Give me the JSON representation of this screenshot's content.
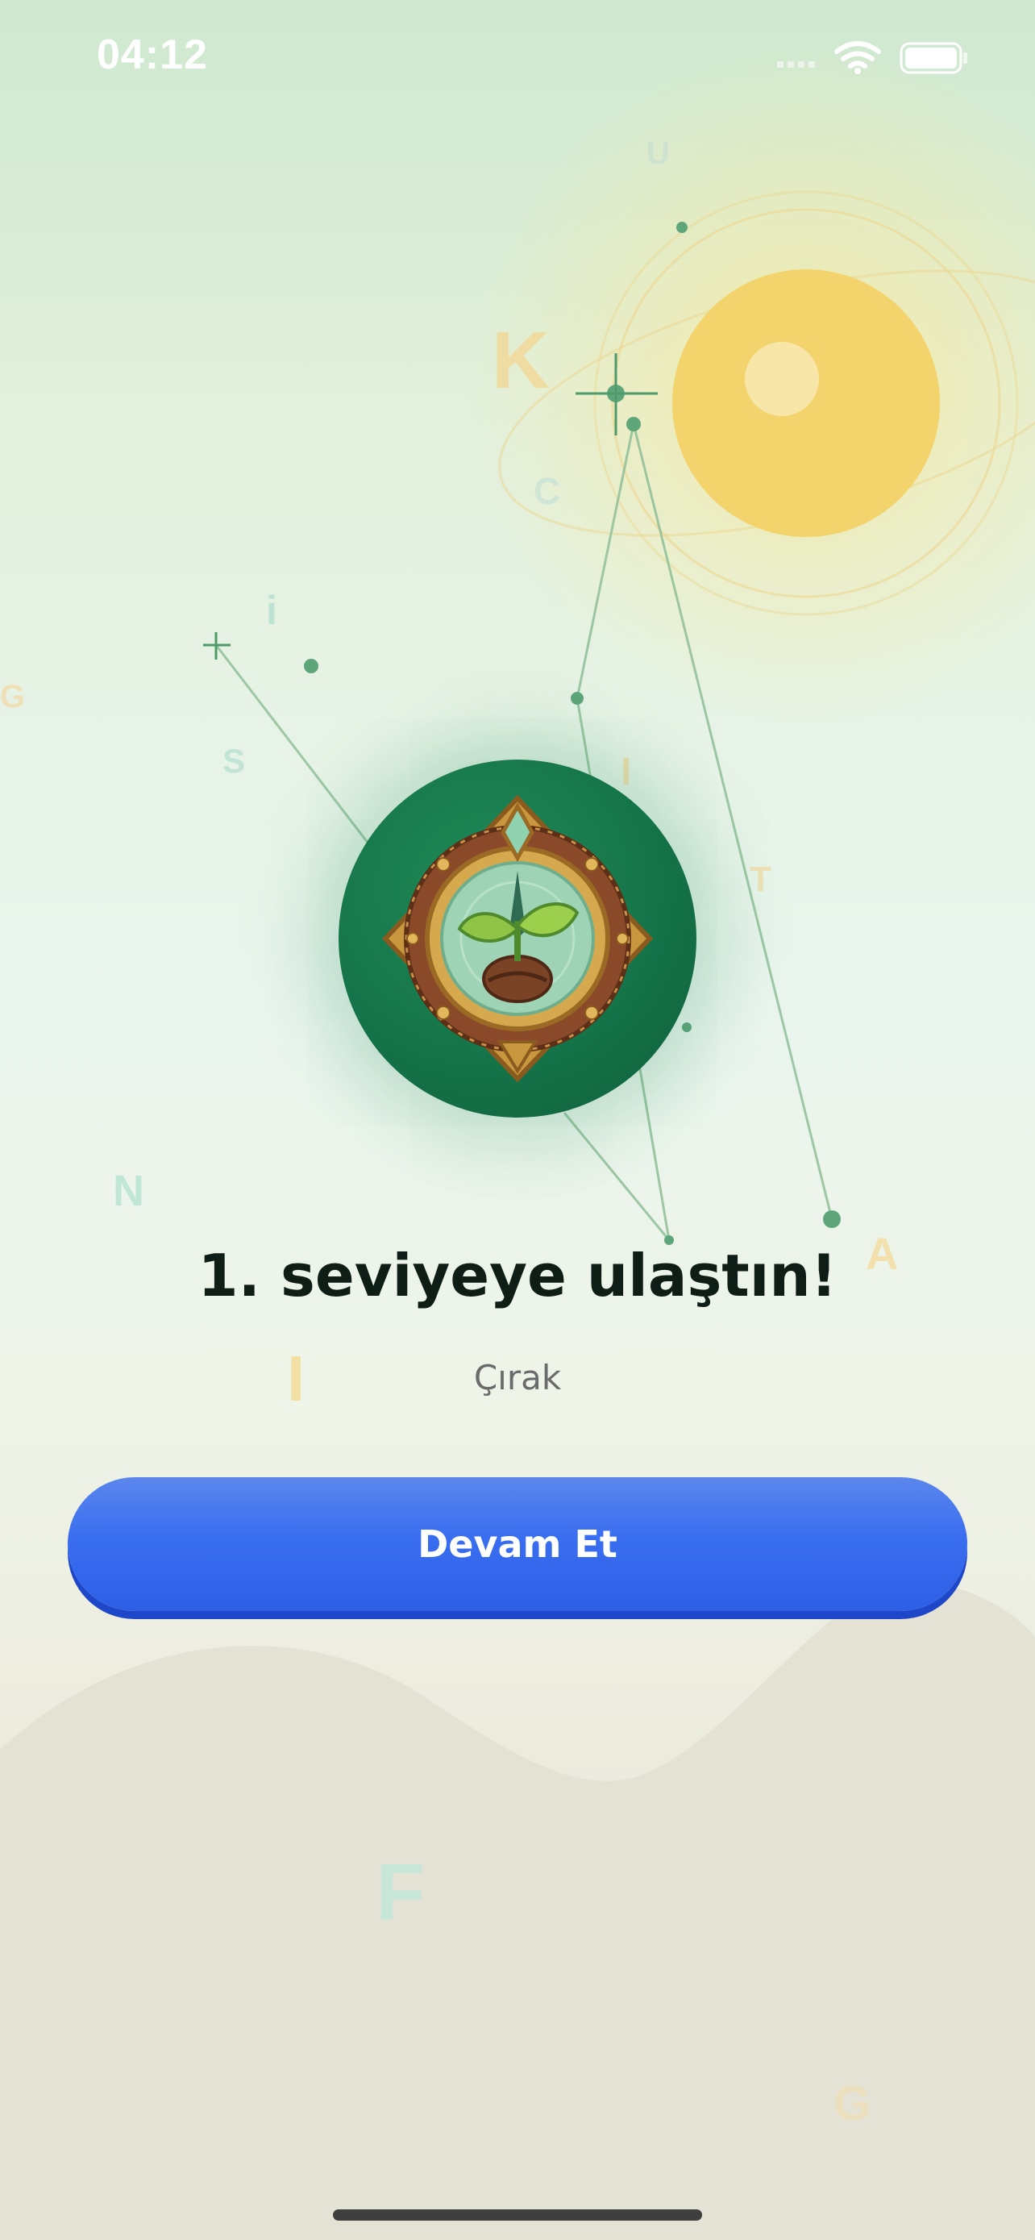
{
  "status_bar": {
    "time": "04:12",
    "icons": [
      "signal-icon",
      "wifi-icon",
      "battery-icon"
    ]
  },
  "level_up": {
    "title": "1. seviyeye ulaştın!",
    "rank": "Çırak",
    "badge_icon": "sprout-compass-badge-icon"
  },
  "actions": {
    "continue_label": "Devam Et"
  },
  "decorative_letters": [
    "K",
    "C",
    "U",
    "i",
    "S",
    "G",
    "I",
    "T",
    "N",
    "A",
    "I",
    "F",
    "G"
  ],
  "colors": {
    "accent_blue": "#3a6ef0",
    "badge_green": "#157449",
    "sun_yellow": "#f2d36c"
  }
}
